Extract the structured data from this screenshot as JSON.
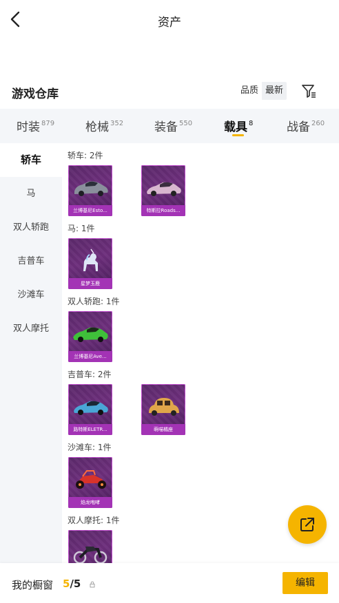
{
  "header": {
    "title": "资产"
  },
  "warehouse": {
    "title": "游戏仓库",
    "sort_options": [
      {
        "label": "品质",
        "active": false
      },
      {
        "label": "最新",
        "active": true
      }
    ]
  },
  "tabs": [
    {
      "label": "时装",
      "count": "879"
    },
    {
      "label": "枪械",
      "count": "352"
    },
    {
      "label": "装备",
      "count": "550"
    },
    {
      "label": "载具",
      "count": "8",
      "active": true
    },
    {
      "label": "战备",
      "count": "260"
    }
  ],
  "sidebar": {
    "items": [
      {
        "label": "轿车",
        "active": true
      },
      {
        "label": "马"
      },
      {
        "label": "双人轿跑"
      },
      {
        "label": "吉普车"
      },
      {
        "label": "沙滩车"
      },
      {
        "label": "双人摩托"
      }
    ]
  },
  "sections": [
    {
      "label": "轿车: 2件",
      "items": [
        {
          "name": "兰博基尼Esto...",
          "art": "car-gray"
        },
        {
          "name": "特斯拉Roads...",
          "art": "car-pink"
        }
      ]
    },
    {
      "label": "马: 1件",
      "items": [
        {
          "name": "星梦玉鹿",
          "art": "unicorn"
        }
      ]
    },
    {
      "label": "双人轿跑: 1件",
      "items": [
        {
          "name": "兰博基尼Ave...",
          "art": "car-green"
        }
      ]
    },
    {
      "label": "吉普车: 2件",
      "items": [
        {
          "name": "路特斯ELETR...",
          "art": "car-blue"
        },
        {
          "name": "萌喵橘座",
          "art": "car-orange"
        }
      ]
    },
    {
      "label": "沙滩车: 1件",
      "items": [
        {
          "name": "焰龙咆哮",
          "art": "atv-red"
        }
      ]
    },
    {
      "label": "双人摩托: 1件",
      "items": [
        {
          "name": "",
          "art": "moto-dark"
        }
      ]
    }
  ],
  "bottom": {
    "label": "我的橱窗",
    "current": "5",
    "total": "/5",
    "edit_label": "编辑"
  },
  "colors": {
    "accent": "#f5b400",
    "card_bg": "#6e2f7d",
    "card_name_bg": "#a333b5"
  },
  "icons": {
    "back": "chevron-left-icon",
    "filter": "filter-icon",
    "share": "share-external-icon"
  }
}
